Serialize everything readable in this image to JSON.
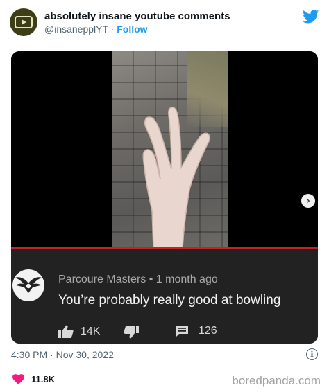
{
  "tweet": {
    "display_name": "absolutely insane youtube comments",
    "handle": "@insanepplYT",
    "separator": "·",
    "follow_label": "Follow",
    "timestamp": "4:30 PM · Nov 30, 2022",
    "like_count": "11.8K"
  },
  "embedded_comment": {
    "author": "Parcoure Masters",
    "bullet": "•",
    "age": "1 month ago",
    "text": "You’re probably really good at bowling",
    "likes": "14K",
    "replies": "126"
  },
  "watermark": "boredpanda.com",
  "colors": {
    "accent": "#1d9bf0",
    "heart": "#f91880",
    "progress": "#cc1f1f",
    "comment_bg": "#222222"
  },
  "icons": [
    "youtube-icon",
    "twitter-bird-icon",
    "thumbs-up-icon",
    "thumbs-down-icon",
    "reply-icon",
    "heart-icon",
    "info-icon",
    "chevron-right-icon"
  ]
}
